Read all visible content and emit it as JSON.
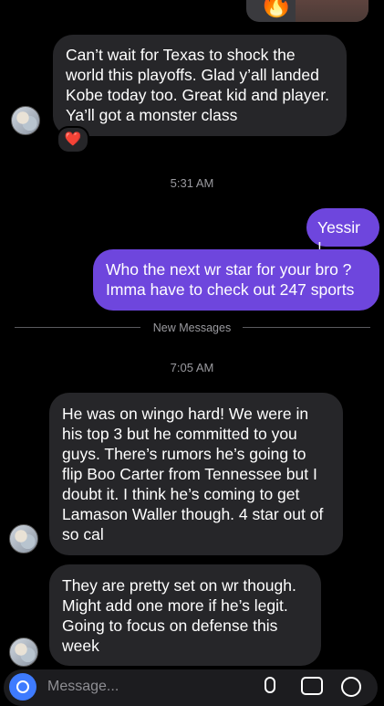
{
  "messages": [
    {
      "id": "m1",
      "sender": "other",
      "text": "Can’t wait for Texas to shock the world this playoffs. Glad y’all landed Kobe today too. Great kid and player. Ya’ll got a monster class"
    },
    {
      "id": "m2",
      "sender": "me",
      "text": "Yessir !"
    },
    {
      "id": "m3",
      "sender": "me",
      "text": "Who the next wr star for your bro ? Imma have to check out 247 sports"
    },
    {
      "id": "m4",
      "sender": "other",
      "text": "He was on wingo hard! We were in his top 3 but he committed to you guys. There’s rumors he’s going to flip Boo Carter from Tennessee but I doubt it. I think he’s coming to get Lamason Waller though. 4 star out of so cal"
    },
    {
      "id": "m5",
      "sender": "other",
      "text": "They are pretty set on wr though. Might add one more if he’s legit. Going to focus on defense this week"
    }
  ],
  "reaction": {
    "emoji": "❤️",
    "color": "#e0245e"
  },
  "timestamps": {
    "t1": "5:31 AM",
    "t2": "7:05 AM"
  },
  "divider": {
    "label": "New Messages"
  },
  "composer": {
    "placeholder": "Message..."
  },
  "icons": {
    "top_emoji": "🔥"
  },
  "colors": {
    "incoming_bubble": "#262629",
    "outgoing_bubble": "#6e46dd",
    "background": "#000000"
  }
}
